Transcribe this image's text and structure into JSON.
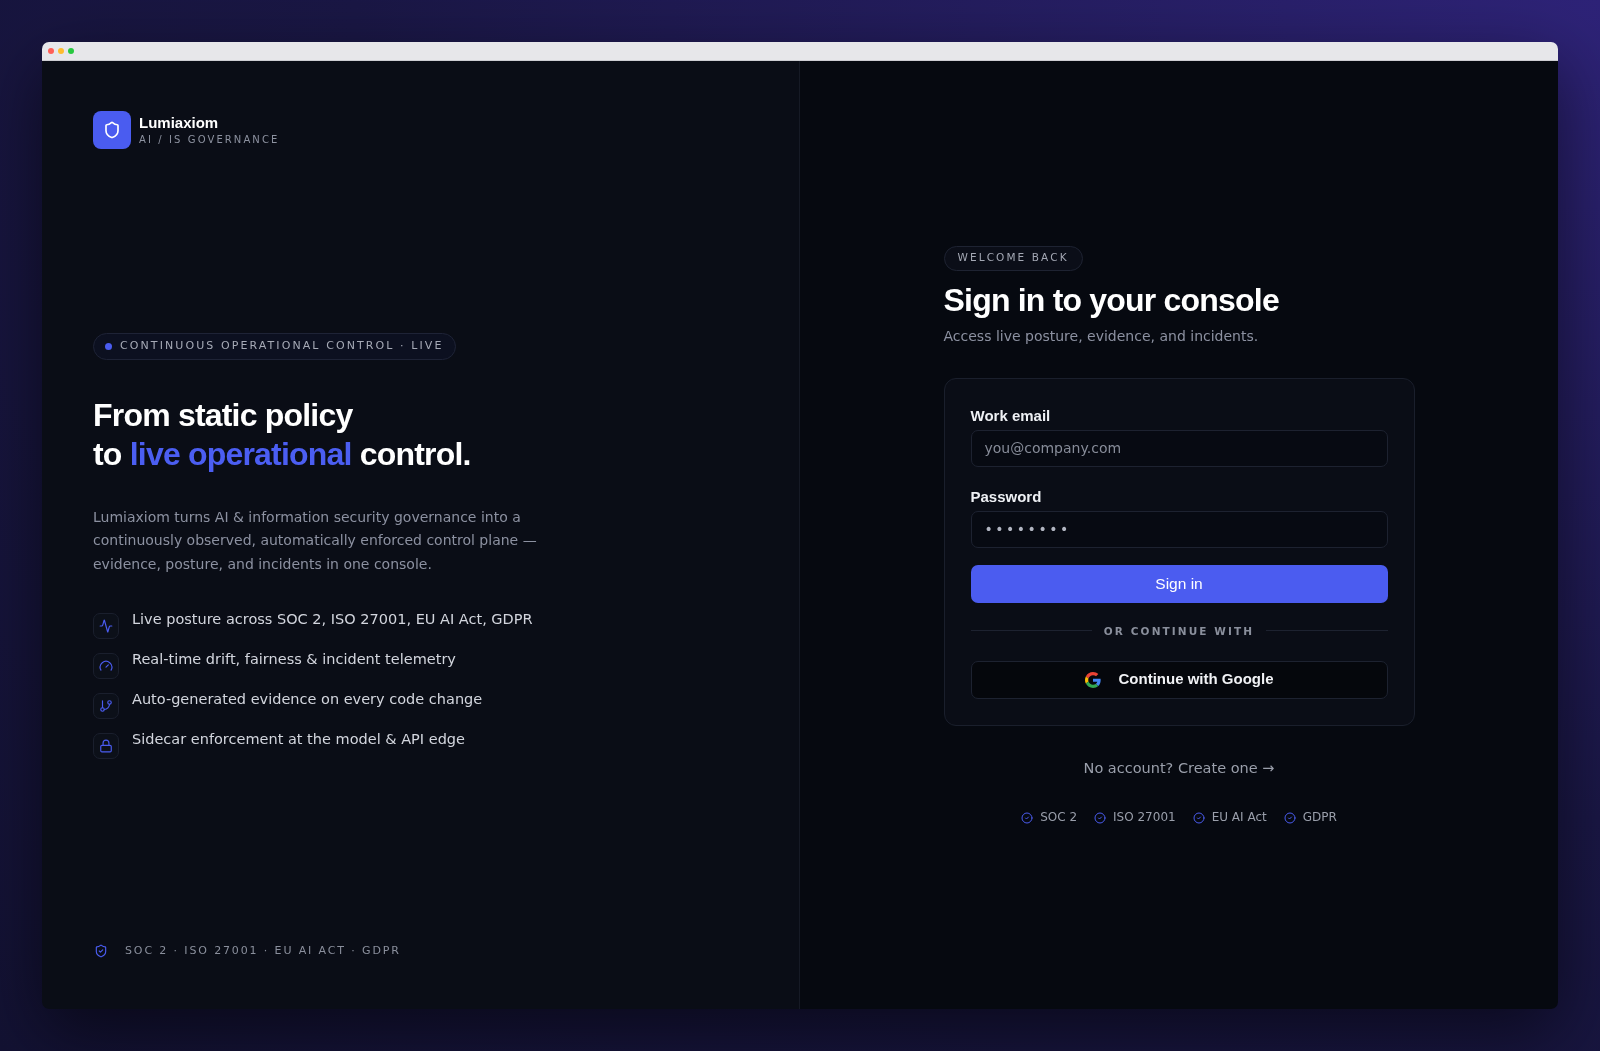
{
  "brand": {
    "name": "Lumiaxiom",
    "tagline": "AI / IS GOVERNANCE"
  },
  "hero": {
    "status": "CONTINUOUS OPERATIONAL CONTROL · LIVE",
    "headline": [
      [
        {
          "text": "From static policy",
          "highlight": false
        }
      ],
      [
        {
          "text": "to ",
          "highlight": false
        },
        {
          "text": "live operational",
          "highlight": true
        },
        {
          "text": " control.",
          "highlight": false
        }
      ]
    ],
    "description": "Lumiaxiom turns AI & information security governance into a continuously observed, automatically enforced control plane — evidence, posture, and incidents in one console.",
    "features": [
      "Live posture across SOC 2, ISO 27001, EU AI Act, GDPR",
      "Real-time drift, fairness & incident telemetry",
      "Auto-generated evidence on every code change",
      "Sidecar enforcement at the model & API edge"
    ]
  },
  "footer": {
    "compliance": "SOC 2 · ISO 27001 · EU AI ACT · GDPR"
  },
  "signin": {
    "eyebrow": "WELCOME BACK",
    "title": "Sign in to your console",
    "subtitle": "Access live posture, evidence, and incidents.",
    "fields": [
      {
        "kind": "email",
        "label": "Work email",
        "placeholder": "you@company.com"
      },
      {
        "kind": "password",
        "label": "Password",
        "placeholder": "••••••••"
      }
    ],
    "submit": "Sign in",
    "divider": "OR CONTINUE WITH",
    "sso_button": "Continue with Google",
    "signup_link": "No account? Create one →",
    "certifications": [
      "SOC 2",
      "ISO 27001",
      "EU AI Act",
      "GDPR"
    ]
  }
}
